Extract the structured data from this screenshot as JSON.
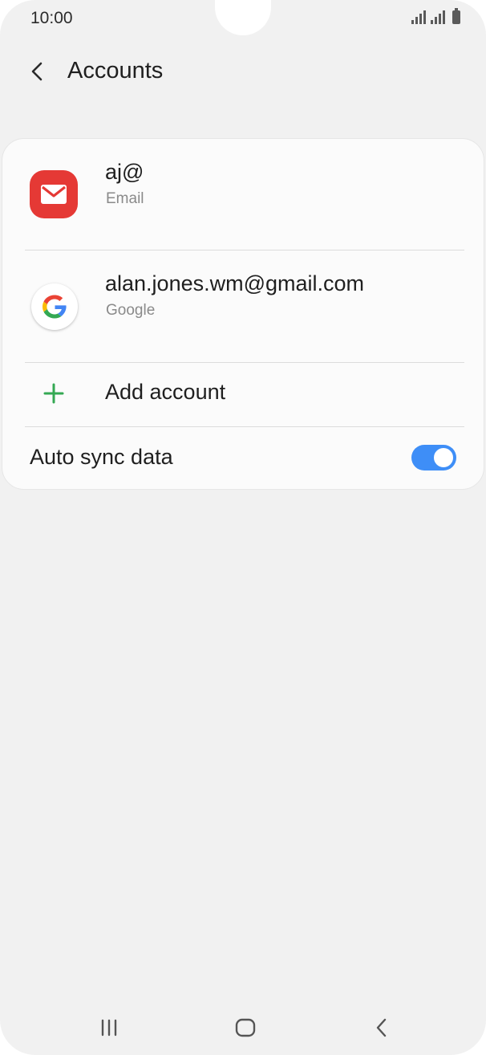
{
  "status_bar": {
    "time": "10:00"
  },
  "header": {
    "title": "Accounts",
    "back_icon": "chevron-left-icon"
  },
  "accounts": [
    {
      "name": "aj@",
      "type": "Email",
      "icon": "email-app-icon",
      "icon_color": "#e53935"
    },
    {
      "name": "alan.jones.wm@gmail.com",
      "type": "Google",
      "icon": "google-icon"
    }
  ],
  "add_account": {
    "label": "Add account",
    "icon": "plus-icon",
    "icon_color": "#34a853"
  },
  "auto_sync": {
    "label": "Auto sync data",
    "enabled": true,
    "toggle_color": "#3e8ef7"
  },
  "nav_bar": {
    "recents_icon": "recents-icon",
    "home_icon": "home-icon",
    "back_icon": "back-icon"
  }
}
